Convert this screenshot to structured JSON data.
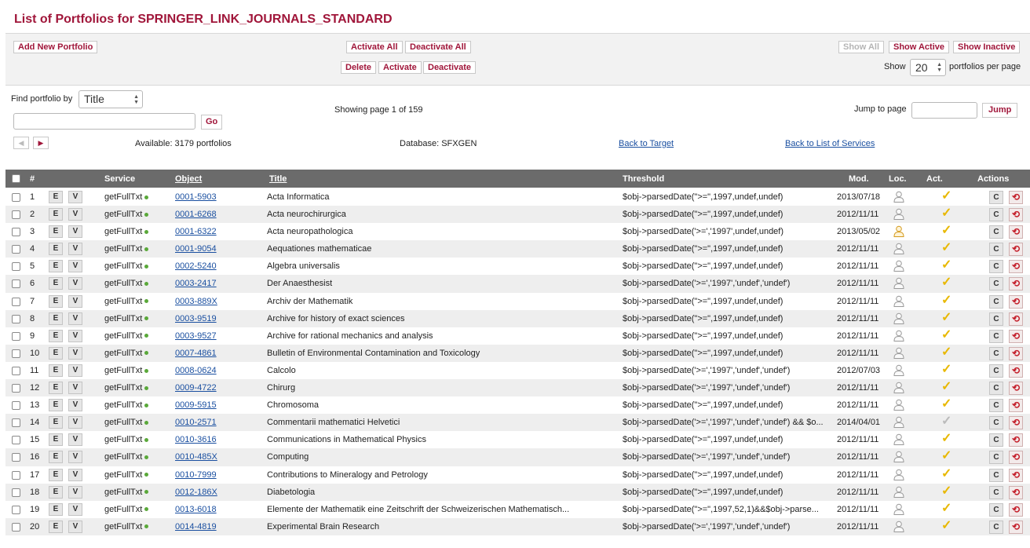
{
  "page": {
    "title": "List of Portfolios for SPRINGER_LINK_JOURNALS_STANDARD"
  },
  "toolbar": {
    "add_new": "Add New Portfolio",
    "activate_all": "Activate All",
    "deactivate_all": "Deactivate All",
    "delete": "Delete",
    "activate": "Activate",
    "deactivate": "Deactivate",
    "show_all": "Show All",
    "show_active": "Show Active",
    "show_inactive": "Show Inactive",
    "show_label": "Show",
    "per_page_value": "20",
    "per_page_suffix": "portfolios per page"
  },
  "search": {
    "find_by_label": "Find portfolio by",
    "find_by_value": "Title",
    "search_value": "",
    "go": "Go",
    "showing": "Showing page 1 of 159",
    "jump_label": "Jump to page",
    "jump_value": "",
    "jump": "Jump",
    "available": "Available: 3179 portfolios",
    "database": "Database: SFXGEN",
    "back_to_target": "Back to Target",
    "back_to_services": "Back to List of Services"
  },
  "columns": {
    "num": "#",
    "service": "Service",
    "object": "Object",
    "title": "Title",
    "threshold": "Threshold",
    "mod": "Mod.",
    "loc": "Loc.",
    "act": "Act.",
    "actions": "Actions"
  },
  "row_buttons": {
    "edit": "E",
    "view": "V",
    "copy": "C"
  },
  "icons": {
    "user": "user-icon",
    "check": "checkmark-icon",
    "delete": "delete-icon",
    "prev": "arrow-left-icon",
    "next": "arrow-right-icon"
  },
  "colors": {
    "brand": "#a0163a",
    "active_check": "#e8b800",
    "inactive_check": "#bbbbbb",
    "service_dot": "#5aa83a"
  },
  "rows": [
    {
      "num": "1",
      "service": "getFullTxt",
      "object": "0001-5903",
      "title": "Acta Informatica",
      "threshold": "$obj->parsedDate(\">=\",1997,undef,undef)",
      "mod": "2013/07/18",
      "loc_highlight": false,
      "active": true
    },
    {
      "num": "2",
      "service": "getFullTxt",
      "object": "0001-6268",
      "title": "Acta neurochirurgica",
      "threshold": "$obj->parsedDate(\">=\",1997,undef,undef)",
      "mod": "2012/11/11",
      "loc_highlight": false,
      "active": true
    },
    {
      "num": "3",
      "service": "getFullTxt",
      "object": "0001-6322",
      "title": "Acta neuropathologica",
      "threshold": "$obj->parsedDate('>=','1997',undef,undef)",
      "mod": "2013/05/02",
      "loc_highlight": true,
      "active": true
    },
    {
      "num": "4",
      "service": "getFullTxt",
      "object": "0001-9054",
      "title": "Aequationes mathematicae",
      "threshold": "$obj->parsedDate(\">=\",1997,undef,undef)",
      "mod": "2012/11/11",
      "loc_highlight": false,
      "active": true
    },
    {
      "num": "5",
      "service": "getFullTxt",
      "object": "0002-5240",
      "title": "Algebra universalis",
      "threshold": "$obj->parsedDate(\">=\",1997,undef,undef)",
      "mod": "2012/11/11",
      "loc_highlight": false,
      "active": true
    },
    {
      "num": "6",
      "service": "getFullTxt",
      "object": "0003-2417",
      "title": "Der Anaesthesist",
      "threshold": "$obj->parsedDate('>=','1997','undef','undef')",
      "mod": "2012/11/11",
      "loc_highlight": false,
      "active": true
    },
    {
      "num": "7",
      "service": "getFullTxt",
      "object": "0003-889X",
      "title": "Archiv der Mathematik",
      "threshold": "$obj->parsedDate(\">=\",1997,undef,undef)",
      "mod": "2012/11/11",
      "loc_highlight": false,
      "active": true
    },
    {
      "num": "8",
      "service": "getFullTxt",
      "object": "0003-9519",
      "title": "Archive for history of exact sciences",
      "threshold": "$obj->parsedDate(\">=\",1997,undef,undef)",
      "mod": "2012/11/11",
      "loc_highlight": false,
      "active": true
    },
    {
      "num": "9",
      "service": "getFullTxt",
      "object": "0003-9527",
      "title": "Archive for rational mechanics and analysis",
      "threshold": "$obj->parsedDate(\">=\",1997,undef,undef)",
      "mod": "2012/11/11",
      "loc_highlight": false,
      "active": true
    },
    {
      "num": "10",
      "service": "getFullTxt",
      "object": "0007-4861",
      "title": "Bulletin of Environmental Contamination and Toxicology",
      "threshold": "$obj->parsedDate(\">=\",1997,undef,undef)",
      "mod": "2012/11/11",
      "loc_highlight": false,
      "active": true
    },
    {
      "num": "11",
      "service": "getFullTxt",
      "object": "0008-0624",
      "title": "Calcolo",
      "threshold": "$obj->parsedDate('>=','1997','undef','undef')",
      "mod": "2012/07/03",
      "loc_highlight": false,
      "active": true
    },
    {
      "num": "12",
      "service": "getFullTxt",
      "object": "0009-4722",
      "title": "Chirurg",
      "threshold": "$obj->parsedDate('>=','1997','undef','undef')",
      "mod": "2012/11/11",
      "loc_highlight": false,
      "active": true
    },
    {
      "num": "13",
      "service": "getFullTxt",
      "object": "0009-5915",
      "title": "Chromosoma",
      "threshold": "$obj->parsedDate(\">=\",1997,undef,undef)",
      "mod": "2012/11/11",
      "loc_highlight": false,
      "active": true
    },
    {
      "num": "14",
      "service": "getFullTxt",
      "object": "0010-2571",
      "title": "Commentarii mathematici Helvetici",
      "threshold": "$obj->parsedDate('>=','1997','undef','undef') && $o...",
      "mod": "2014/04/01",
      "loc_highlight": false,
      "active": false
    },
    {
      "num": "15",
      "service": "getFullTxt",
      "object": "0010-3616",
      "title": "Communications in Mathematical Physics",
      "threshold": "$obj->parsedDate(\">=\",1997,undef,undef)",
      "mod": "2012/11/11",
      "loc_highlight": false,
      "active": true
    },
    {
      "num": "16",
      "service": "getFullTxt",
      "object": "0010-485X",
      "title": "Computing",
      "threshold": "$obj->parsedDate('>=','1997','undef','undef')",
      "mod": "2012/11/11",
      "loc_highlight": false,
      "active": true
    },
    {
      "num": "17",
      "service": "getFullTxt",
      "object": "0010-7999",
      "title": "Contributions to Mineralogy and Petrology",
      "threshold": "$obj->parsedDate(\">=\",1997,undef,undef)",
      "mod": "2012/11/11",
      "loc_highlight": false,
      "active": true
    },
    {
      "num": "18",
      "service": "getFullTxt",
      "object": "0012-186X",
      "title": "Diabetologia",
      "threshold": "$obj->parsedDate(\">=\",1997,undef,undef)",
      "mod": "2012/11/11",
      "loc_highlight": false,
      "active": true
    },
    {
      "num": "19",
      "service": "getFullTxt",
      "object": "0013-6018",
      "title": "Elemente der Mathematik eine Zeitschrift der Schweizerischen Mathematisch...",
      "threshold": "$obj->parsedDate(\">=\",1997,52,1)&&$obj->parse...",
      "mod": "2012/11/11",
      "loc_highlight": false,
      "active": true
    },
    {
      "num": "20",
      "service": "getFullTxt",
      "object": "0014-4819",
      "title": "Experimental Brain Research",
      "threshold": "$obj->parsedDate('>=','1997','undef','undef')",
      "mod": "2012/11/11",
      "loc_highlight": false,
      "active": true
    }
  ]
}
